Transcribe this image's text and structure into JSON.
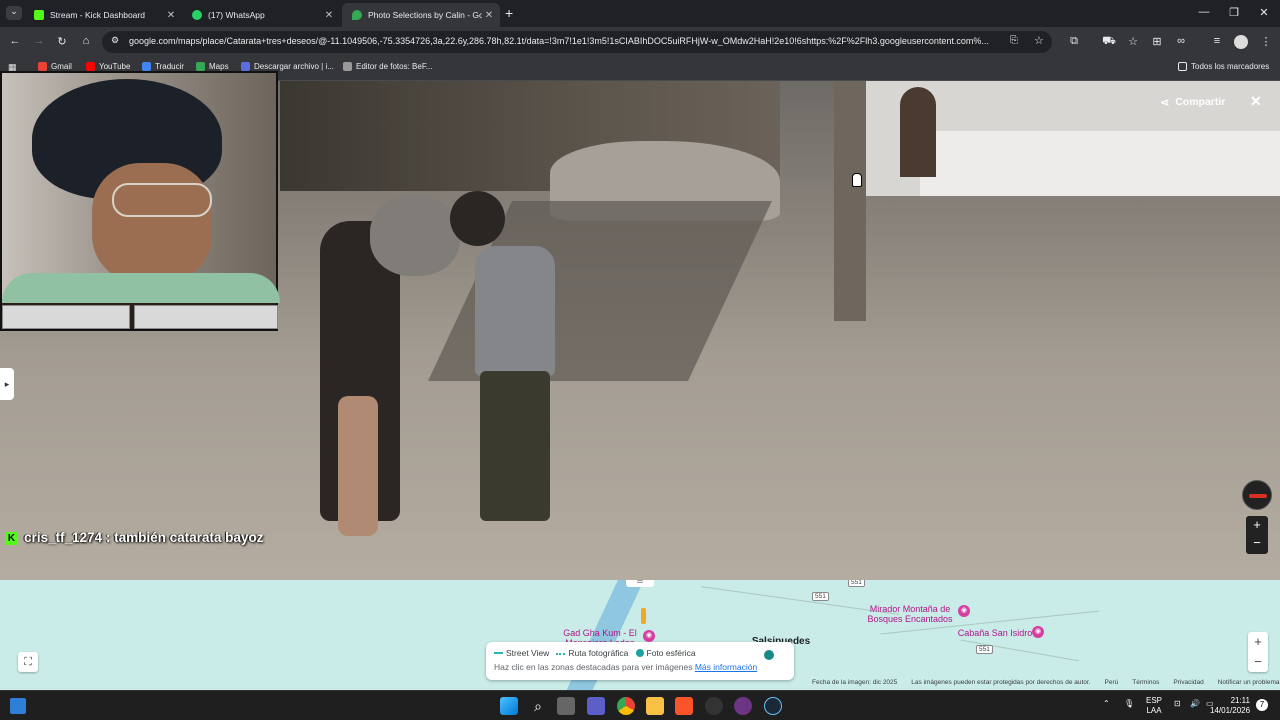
{
  "tabs": [
    {
      "title": "Stream - Kick Dashboard",
      "active": false,
      "favicon_color": "#53fc18"
    },
    {
      "title": "(17) WhatsApp",
      "active": false,
      "favicon_color": "#25d366"
    },
    {
      "title": "Photo Selections by Calin - Goo",
      "active": true,
      "favicon_color": "#34a853"
    }
  ],
  "new_tab_label": "+",
  "window_controls": {
    "minimize": "—",
    "restore": "❐",
    "close": "✕"
  },
  "toolbar": {
    "url": "google.com/maps/place/Catarata+tres+deseos/@-11.1049506,-75.3354726,3a,22.6y,286.78h,82.1t/data=!3m7!1e1!3m5!1sCIABIhDOC5uiRFHjW-w_OMdw2HaH!2e10!6shttps:%2F%2Flh3.googleusercontent.com%..."
  },
  "bookmarks": [
    {
      "label": "Gmail",
      "color": "#ea4335"
    },
    {
      "label": "YouTube",
      "color": "#ff0000"
    },
    {
      "label": "Traducir",
      "color": "#4285f4"
    },
    {
      "label": "Maps",
      "color": "#34a853"
    },
    {
      "label": "Descargar archivo | i...",
      "color": "#5b6ee1"
    },
    {
      "label": "Editor de fotos: BeF...",
      "color": "#999999"
    }
  ],
  "bookmarks_all": "Todos los marcadores",
  "streetview": {
    "share_label": "Compartir",
    "close_label": "✕",
    "zoom_in": "+",
    "zoom_out": "−"
  },
  "chat": {
    "username": "cris_tf_1274",
    "message": ": también catarata bayoz"
  },
  "map": {
    "labels": [
      {
        "text": "Gad Gha Kum - El Mensajero Lodge",
        "kind": "poi"
      },
      {
        "text": "Mirador Montaña de Bosques Encantados",
        "kind": "poi"
      },
      {
        "text": "Cabaña San Isidro",
        "kind": "poi"
      },
      {
        "text": "Salsipuedes",
        "kind": "town"
      }
    ],
    "road_shields": [
      "551",
      "551",
      "551"
    ],
    "legend": {
      "street_view": "Street View",
      "photo_route": "Ruta fotográfica",
      "spherical_photo": "Foto esférica",
      "hint": "Haz clic en las zonas destacadas para ver imágenes",
      "more_info": "Más información"
    },
    "footer": {
      "image_date": "Fecha de la imagen: dic 2025",
      "copyright": "Las imágenes pueden estar protegidas por derechos de autor.",
      "country": "Perú",
      "terms": "Términos",
      "privacy": "Privacidad",
      "report": "Notificar un problema"
    },
    "zoom_in": "+",
    "zoom_out": "−"
  },
  "taskbar": {
    "language": "ESP",
    "layout": "LAA",
    "time": "21:11",
    "date": "14/01/2026",
    "notification_count": "7",
    "apps": [
      "start",
      "search",
      "task-view",
      "chat",
      "chrome",
      "file-explorer",
      "brave",
      "app-red-dot",
      "obs",
      "steam"
    ]
  }
}
